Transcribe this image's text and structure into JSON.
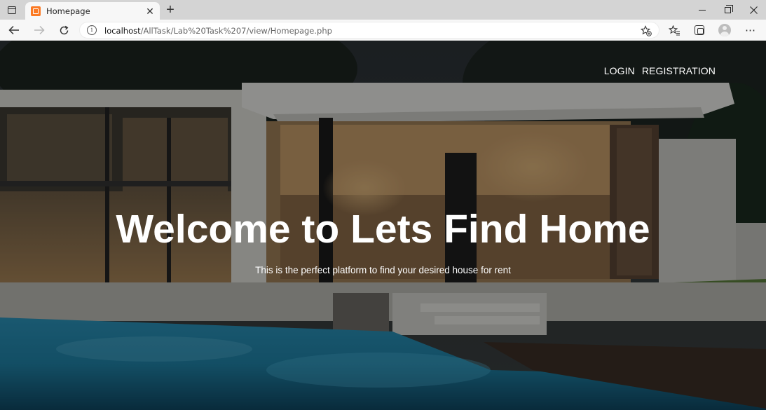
{
  "browser": {
    "tab_title": "Homepage",
    "tab_close": "✕",
    "new_tab": "+",
    "url_host": "localhost",
    "url_path": "/AllTask/Lab%20Task%207/view/Homepage.php",
    "more": "⋯"
  },
  "nav": {
    "login": "LOGIN",
    "registration": "REGISTRATION"
  },
  "hero": {
    "title": "Welcome to Lets Find Home",
    "subtitle": "This is the perfect platform to find your desired house for rent"
  },
  "colors": {
    "favicon": "#fb7a24",
    "pool": "#1f7fa3"
  },
  "icons": [
    "tab-actions-icon",
    "xampp-favicon-icon",
    "close-icon",
    "plus-icon",
    "back-arrow-icon",
    "forward-arrow-icon",
    "reload-icon",
    "info-icon",
    "add-favorite-icon",
    "favorites-icon",
    "collections-icon",
    "profile-icon",
    "more-icon",
    "minimize-icon",
    "maximize-icon",
    "window-close-icon"
  ]
}
